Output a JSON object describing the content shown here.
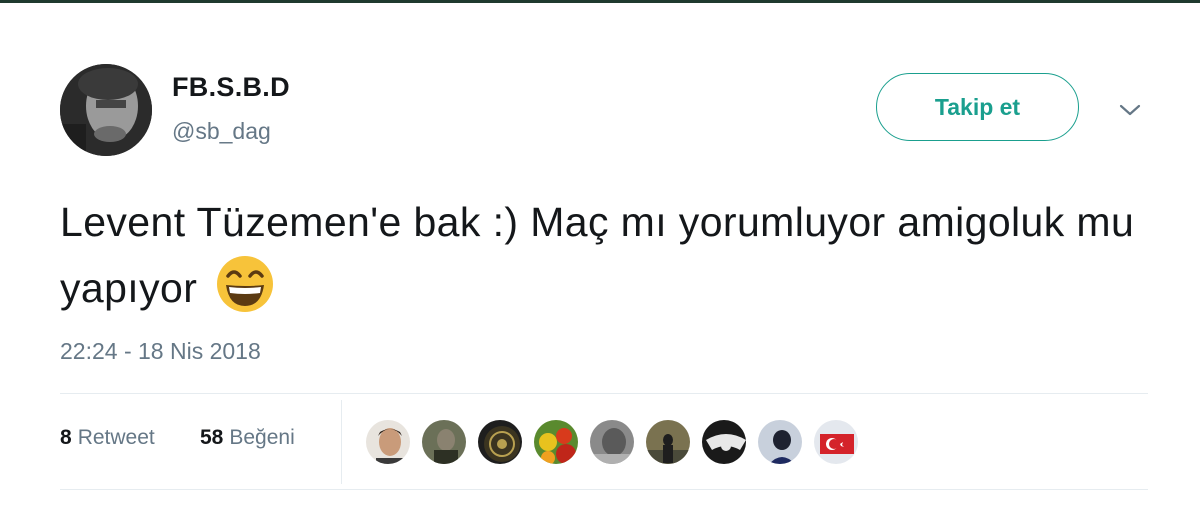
{
  "user": {
    "display_name": "FB.S.B.D",
    "handle": "@sb_dag"
  },
  "follow_button_label": "Takip et",
  "tweet": {
    "text": "Levent Tüzemen'e bak :) Maç mı yorumluyor amigoluk mu yapıyor",
    "emoji": "grinning-face-with-smiling-eyes",
    "timestamp": "22:24 - 18 Nis 2018"
  },
  "stats": {
    "retweet_count": "8",
    "retweet_label": "Retweet",
    "like_count": "58",
    "like_label": "Beğeni"
  },
  "liker_avatars_count": 9,
  "colors": {
    "accent": "#1a9f8e",
    "secondary_text": "#657786",
    "divider": "#e6ecf0"
  }
}
